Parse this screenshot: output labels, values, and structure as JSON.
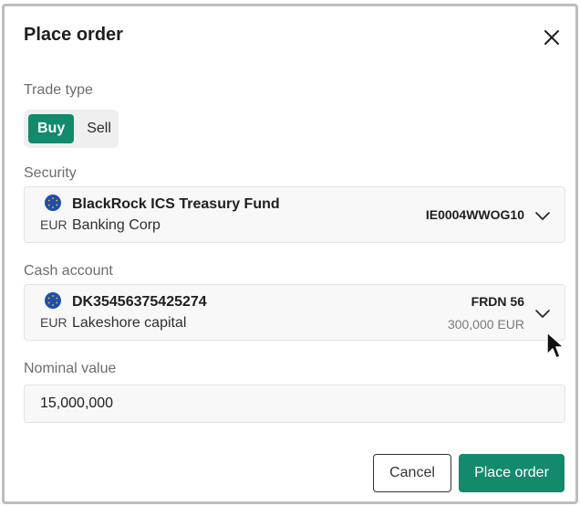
{
  "dialog": {
    "title": "Place order"
  },
  "trade_type": {
    "label": "Trade type",
    "options": [
      "Buy",
      "Sell"
    ],
    "selected": "Buy"
  },
  "security": {
    "label": "Security",
    "name": "BlackRock ICS Treasury Fund",
    "issuer": "Banking Corp",
    "currency": "EUR",
    "isin": "IE0004WWOG10"
  },
  "cash_account": {
    "label": "Cash account",
    "iban": "DK35456375425274",
    "holder": "Lakeshore capital",
    "currency": "EUR",
    "code": "FRDN 56",
    "balance": "300,000 EUR"
  },
  "nominal_value": {
    "label": "Nominal value",
    "value": "15,000,000"
  },
  "actions": {
    "cancel": "Cancel",
    "submit": "Place order"
  },
  "icons": {
    "flag": "eu-flag-icon",
    "close": "close-icon",
    "chevron": "chevron-down-icon",
    "cursor": "mouse-cursor-icon"
  },
  "colors": {
    "accent": "#138a6b",
    "flag": "#1f4fa8"
  }
}
